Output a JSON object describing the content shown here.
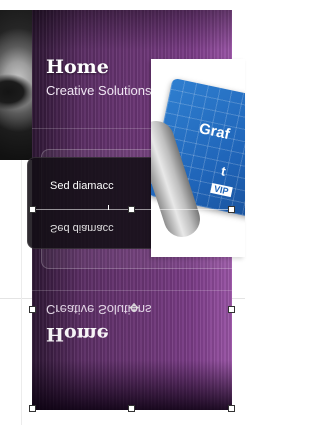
{
  "header": {
    "title": "Home",
    "subtitle": "Creative Solutions"
  },
  "content": {
    "body_text": "Sed diamacc"
  },
  "reflection": {
    "title": "Home",
    "subtitle": "Creative Solutions",
    "body_text": "Sed diamacc"
  },
  "image": {
    "label_1": "Graf",
    "label_2": "t",
    "label_3": "VIP"
  },
  "colors": {
    "panel_dark": "#2c1632",
    "panel_mid": "#6b3675",
    "panel_light": "#9a55a6",
    "blueprint": "#1f64b8"
  },
  "icons": {
    "rotate_handle": "rotate-icon"
  }
}
